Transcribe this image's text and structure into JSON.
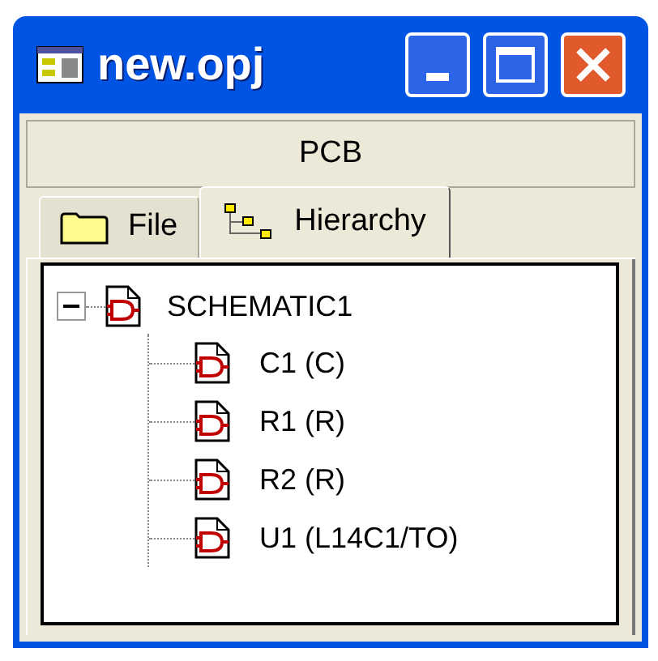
{
  "window": {
    "title": "new.opj"
  },
  "header": {
    "label": "PCB"
  },
  "tabs": [
    {
      "label": "File",
      "kind": "folder",
      "selected": false
    },
    {
      "label": "Hierarchy",
      "kind": "hierarchy",
      "selected": true
    }
  ],
  "tree": [
    {
      "label": "SCHEMATIC1",
      "expanded": true,
      "children": [
        {
          "label": "C1 (C)"
        },
        {
          "label": "R1 (R)"
        },
        {
          "label": "R2 (R)"
        },
        {
          "label": "U1 (L14C1/TO)"
        }
      ]
    }
  ]
}
